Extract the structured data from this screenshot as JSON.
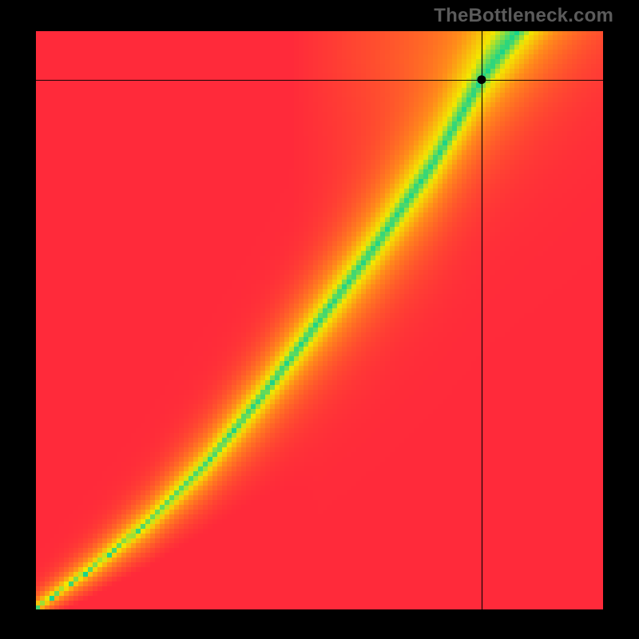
{
  "watermark": "TheBottleneck.com",
  "chart_data": {
    "type": "heatmap",
    "title": "",
    "xlabel": "",
    "ylabel": "",
    "xlim": [
      0,
      1
    ],
    "ylim": [
      0,
      1
    ],
    "grid": false,
    "description": "Bottleneck score heatmap. Green ridge = balanced pairing (score 0). Red = severe bottleneck (score ±1). A crosshair marks a specific point on the ridge.",
    "marker": {
      "x": 0.785,
      "y": 0.915,
      "on_ridge": true
    },
    "ridge_samples": [
      {
        "x": 0.0,
        "y": 0.0
      },
      {
        "x": 0.1,
        "y": 0.07
      },
      {
        "x": 0.2,
        "y": 0.15
      },
      {
        "x": 0.3,
        "y": 0.25
      },
      {
        "x": 0.4,
        "y": 0.37
      },
      {
        "x": 0.5,
        "y": 0.5
      },
      {
        "x": 0.6,
        "y": 0.63
      },
      {
        "x": 0.7,
        "y": 0.77
      },
      {
        "x": 0.785,
        "y": 0.915
      },
      {
        "x": 0.85,
        "y": 1.0
      }
    ],
    "colormap": {
      "name": "red-yellow-green-yellow-red",
      "stops": [
        {
          "t": -1.0,
          "color": "#ff2a3a"
        },
        {
          "t": -0.5,
          "color": "#ff8c1a"
        },
        {
          "t": -0.2,
          "color": "#f3e600"
        },
        {
          "t": 0.0,
          "color": "#18d48a"
        },
        {
          "t": 0.2,
          "color": "#f3e600"
        },
        {
          "t": 0.5,
          "color": "#ff8c1a"
        },
        {
          "t": 1.0,
          "color": "#ff2a3a"
        }
      ]
    }
  }
}
